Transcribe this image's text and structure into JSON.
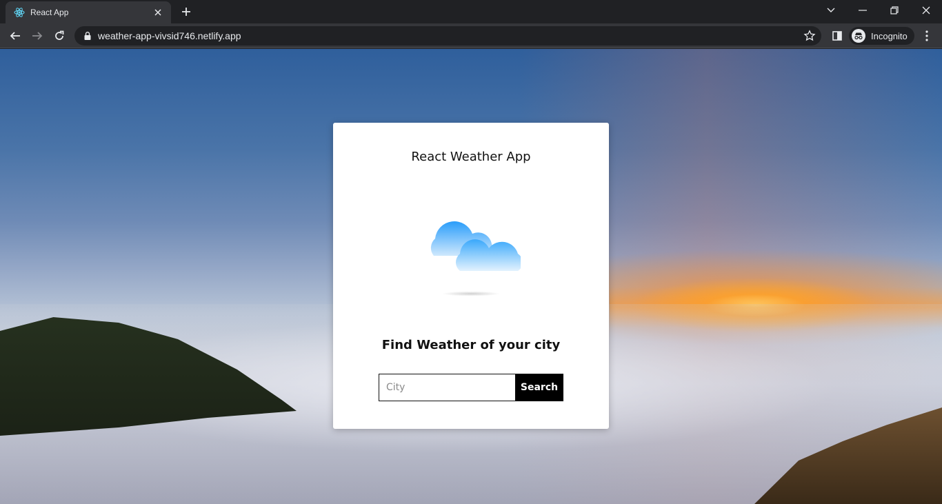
{
  "browser": {
    "tab": {
      "title": "React App",
      "favicon": "react-icon"
    },
    "address": {
      "url": "weather-app-vivsid746.netlify.app"
    },
    "profile": {
      "label": "Incognito",
      "icon": "incognito-icon"
    },
    "colors": {
      "chrome_dark": "#202124",
      "chrome_tab": "#35363a",
      "text": "#e8eaed"
    }
  },
  "app": {
    "title": "React Weather App",
    "illustration": "cloud-icon",
    "subtitle": "Find Weather of your city",
    "search": {
      "placeholder": "City",
      "value": "",
      "button_label": "Search"
    },
    "colors": {
      "card": "#ffffff",
      "button": "#000000",
      "cloud": "#2a9dfa"
    }
  }
}
